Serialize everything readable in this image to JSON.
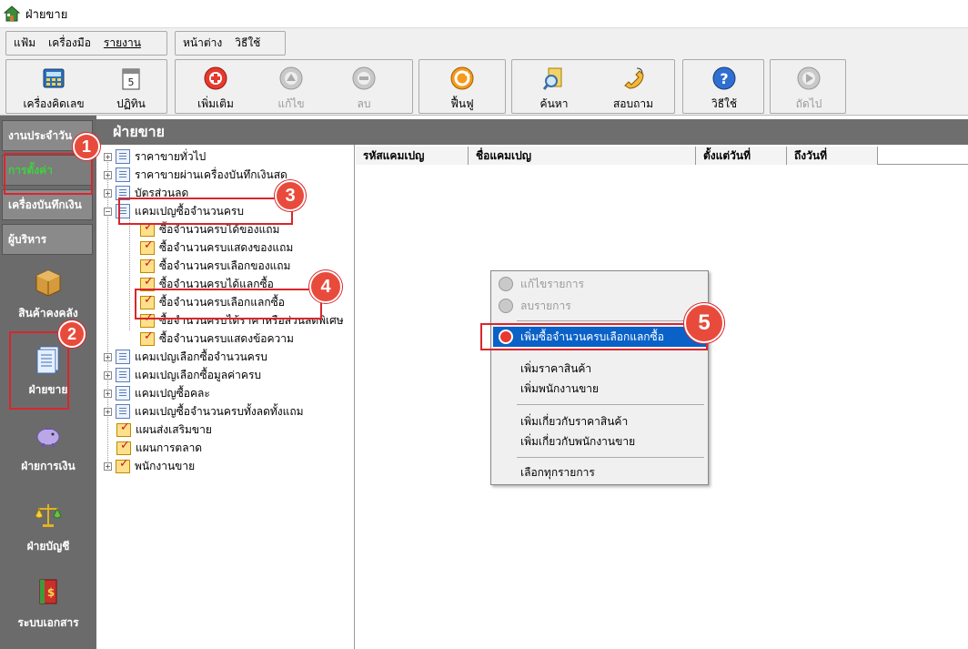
{
  "window": {
    "title": "ฝ่ายขาย"
  },
  "menu": {
    "group1": [
      "แฟ้ม",
      "เครื่องมือ",
      "รายงาน"
    ],
    "group2": [
      "หน้าต่าง",
      "วิธีใช้"
    ]
  },
  "toolbar": {
    "calculator": "เครื่องคิดเลข",
    "calendar": "ปฏิทิน",
    "add": "เพิ่มเติม",
    "edit": "แก้ไข",
    "delete": "ลบ",
    "refresh": "ฟื้นฟู",
    "find": "ค้นหา",
    "inquiry": "สอบถาม",
    "help": "วิธีใช้",
    "next": "ถัดไป"
  },
  "sidebar": {
    "tabs": [
      "งานประจำวัน",
      "การตั้งค่า",
      "เครื่องบันทึกเงิน",
      "ผู้บริหาร"
    ],
    "items": [
      "สินค้าคงคลัง",
      "ฝ่ายขาย",
      "ฝ่ายการเงิน",
      "ฝ่ายบัญชี",
      "ระบบเอกสาร"
    ]
  },
  "content": {
    "header": "ฝ่ายขาย"
  },
  "tree": {
    "nodes": [
      "ราคาขายทั่วไป",
      "ราคาขายผ่านเครื่องบันทึกเงินสด",
      "บัตรส่วนลด",
      "แคมเปญซื้อจำนวนครบ",
      "ซื้อจำนวนครบได้ของแถม",
      "ซื้อจำนวนครบแสดงของแถม",
      "ซื้อจำนวนครบเลือกของแถม",
      "ซื้อจำนวนครบได้แลกซื้อ",
      "ซื้อจำนวนครบเลือกแลกซื้อ",
      "ซื้อจำนวนครบได้ราคาหรือส่วนลดพิเศษ",
      "ซื้อจำนวนครบแสดงข้อความ",
      "แคมเปญเลือกซื้อจำนวนครบ",
      "แคมเปญเลือกซื้อมูลค่าครบ",
      "แคมเปญซื้อคละ",
      "แคมเปญซื้อจำนวนครบทั้งลดทั้งแถม",
      "แผนส่งเสริมขาย",
      "แผนการตลาด",
      "พนักงานขาย"
    ]
  },
  "grid": {
    "columns": [
      "รหัสแคมเปญ",
      "ชื่อแคมเปญ",
      "ตั้งแต่วันที่",
      "ถึงวันที่"
    ]
  },
  "context_menu": {
    "items": [
      "แก้ไขรายการ",
      "ลบรายการ",
      "เพิ่มซื้อจำนวนครบเลือกแลกซื้อ",
      "เพิ่มราคาสินค้า",
      "เพิ่มพนักงานขาย",
      "เพิ่มเกี่ยวกับราคาสินค้า",
      "เพิ่มเกี่ยวกับพนักงานขาย",
      "เลือกทุกรายการ"
    ]
  },
  "callouts": [
    "1",
    "2",
    "3",
    "4",
    "5"
  ],
  "colors": {
    "accent_red": "#d9262e",
    "highlight": "#0a62c8",
    "nav_bg": "#6b6b6b",
    "active_tab": "#3fd13f"
  }
}
